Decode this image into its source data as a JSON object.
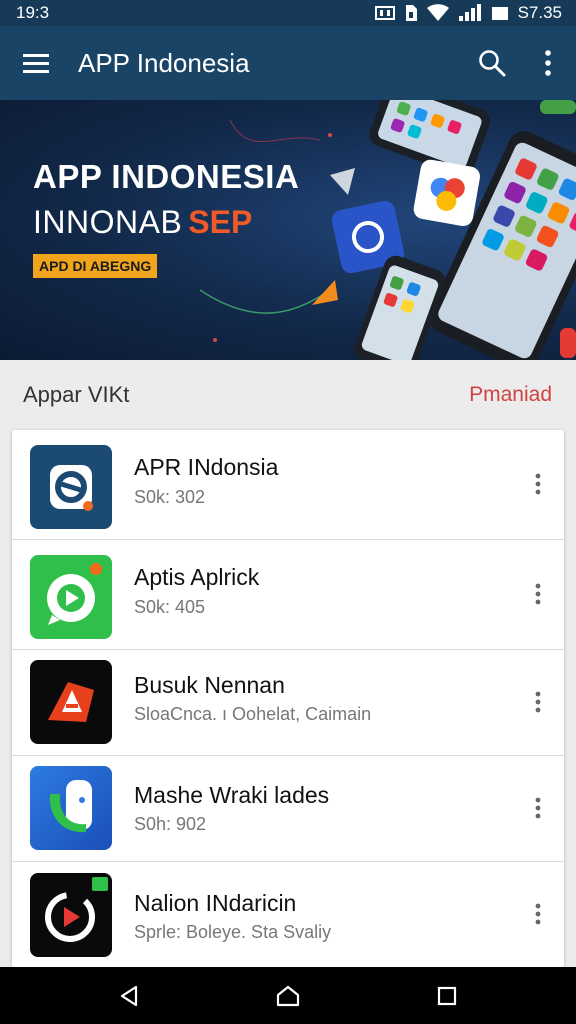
{
  "status_bar": {
    "time": "19:3",
    "right_text": "S7.35",
    "icons": [
      "nfc-icon",
      "sim-icon",
      "wifi-icon",
      "signal-icon",
      "battery-icon"
    ]
  },
  "app_bar": {
    "title": "APP Indonesia",
    "icons": [
      "menu-icon",
      "search-icon",
      "more-vert-icon"
    ]
  },
  "banner": {
    "title": "APP INDONESIA",
    "subtitle_main": "INNONAB",
    "subtitle_accent": "SEP",
    "badge": "APD DI ABEGNG"
  },
  "section": {
    "title": "Appar VIKt",
    "action": "Pmaniad"
  },
  "apps": [
    {
      "name": "APR INdonsia",
      "meta": "S0k: 302"
    },
    {
      "name": "Aptis Aplrick",
      "meta": "S0k: 405"
    },
    {
      "name": "Busuk Nennan",
      "meta": "SloaCnca. ı Oohelat, Caimain"
    },
    {
      "name": "Mashe Wraki lades",
      "meta": "S0h: 902"
    },
    {
      "name": "Nalion INdaricin",
      "meta": "Sprle: Boleye. Sta Svaliy"
    }
  ],
  "nav_bar": {
    "icons": [
      "back-icon",
      "home-icon",
      "recents-icon"
    ]
  },
  "colors": {
    "app_bar": "#1a4466",
    "status_bar": "#163a57",
    "accent_red": "#d14343",
    "banner_badge": "#f0a51c"
  }
}
